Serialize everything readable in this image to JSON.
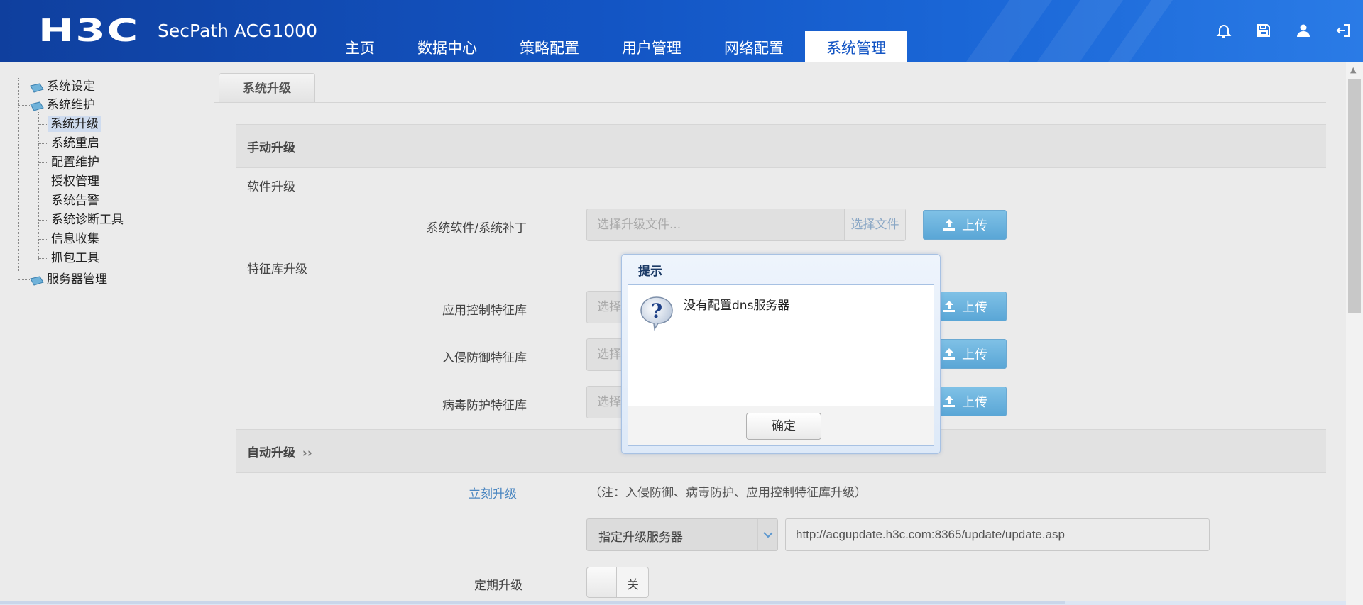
{
  "header": {
    "logo": "H3C",
    "product": "SecPath ACG1000",
    "nav": [
      "主页",
      "数据中心",
      "策略配置",
      "用户管理",
      "网络配置",
      "系统管理"
    ],
    "active_nav": "系统管理",
    "icons": [
      "bell-icon",
      "save-icon",
      "user-icon",
      "logout-icon"
    ]
  },
  "tree": {
    "system_settings": "系统设定",
    "system_maintenance": "系统维护",
    "children": [
      "系统升级",
      "系统重启",
      "配置维护",
      "授权管理",
      "系统告警",
      "系统诊断工具",
      "信息收集",
      "抓包工具"
    ],
    "server_management": "服务器管理"
  },
  "tab": {
    "label": "系统升级"
  },
  "manual": {
    "title": "手动升级",
    "software_title": "软件升级",
    "software_label": "系统软件/系统补丁",
    "file_placeholder": "选择升级文件...",
    "file_placeholder_short": "选择",
    "pick_label": "选择文件",
    "upload_label": "上传",
    "signature_title": "特征库升级",
    "signature_rows": [
      "应用控制特征库",
      "入侵防御特征库",
      "病毒防护特征库"
    ]
  },
  "auto": {
    "title": "自动升级",
    "chevrons": "››",
    "upgrade_now": "立刻升级",
    "note": "（注：入侵防御、病毒防护、应用控制特征库升级）",
    "server_select": "指定升级服务器",
    "server_url": "http://acgupdate.h3c.com:8365/update/update.asp",
    "periodic_label": "定期升级",
    "toggle_label": "关"
  },
  "dialog": {
    "title": "提示",
    "message": "没有配置dns服务器",
    "ok_label": "确定"
  },
  "colors": {
    "header_blue": "#1355c4",
    "upload_blue": "#5aa6d6",
    "link_blue": "#4a86c0"
  }
}
